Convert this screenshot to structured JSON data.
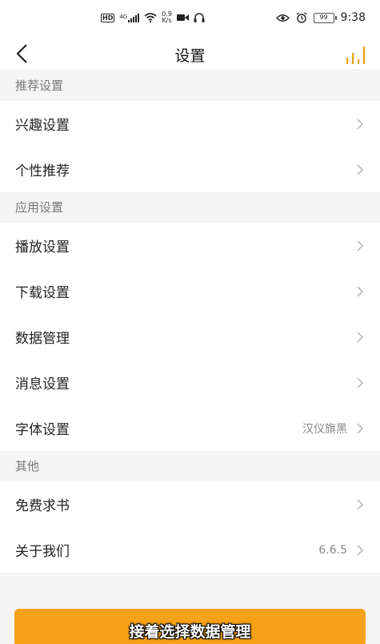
{
  "status_bar": {
    "hd": "HD",
    "network": "4G",
    "speed_value": "0.9",
    "speed_unit": "K/s",
    "battery": "99",
    "time": "9:38"
  },
  "nav": {
    "title": "设置",
    "back_icon": "chevron-left-icon",
    "right_icon": "equalizer-icon",
    "accent_color": "#e7a317"
  },
  "sections": {
    "recommend": {
      "header": "推荐设置",
      "items": [
        {
          "label": "兴趣设置"
        },
        {
          "label": "个性推荐"
        }
      ]
    },
    "app": {
      "header": "应用设置",
      "items": [
        {
          "label": "播放设置"
        },
        {
          "label": "下载设置"
        },
        {
          "label": "数据管理"
        },
        {
          "label": "消息设置"
        },
        {
          "label": "字体设置",
          "value": "汉仪旗黑"
        }
      ]
    },
    "other": {
      "header": "其他",
      "items": [
        {
          "label": "免费求书"
        },
        {
          "label": "关于我们",
          "value": "6.6.5"
        }
      ]
    }
  },
  "caption": "接着选择数据管理",
  "colors": {
    "button": "#f6a117",
    "chevron": "#bbbbbb",
    "section_bg": "#f5f5f5"
  }
}
